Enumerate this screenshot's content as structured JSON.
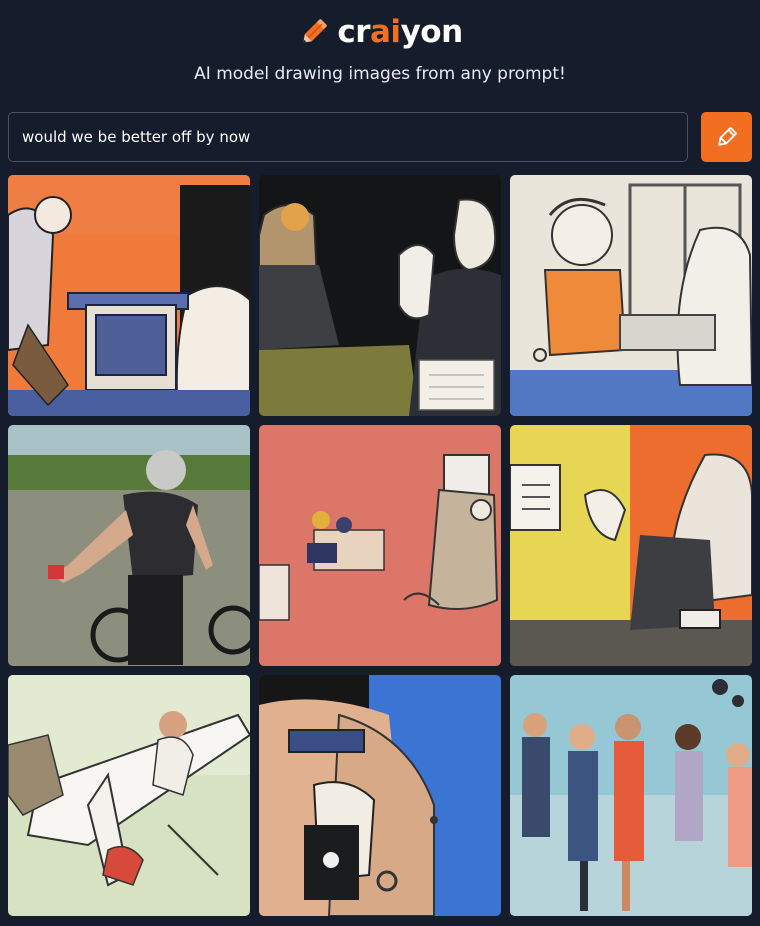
{
  "brand": {
    "name_prefix": "cr",
    "name_accent": "ai",
    "name_suffix": "yon",
    "accent_color": "#f26f21",
    "logo_icon": "pencil-icon"
  },
  "tagline": "AI model drawing images from any prompt!",
  "prompt": {
    "value": "would we be better off by now",
    "placeholder": ""
  },
  "draw_button": {
    "icon": "pencil-icon",
    "color": "#f26f21"
  },
  "results": {
    "count": 9,
    "tiles": [
      {
        "index": 1,
        "depicts": "cartoon figures at a desk, orange background"
      },
      {
        "index": 2,
        "depicts": "cartoon figure at a lectern, dark background"
      },
      {
        "index": 3,
        "depicts": "cartoon figures in an office"
      },
      {
        "index": 4,
        "depicts": "photo of a person on a bicycle"
      },
      {
        "index": 5,
        "depicts": "small figures on a pink background"
      },
      {
        "index": 6,
        "depicts": "figure holding a paper, yellow and orange background"
      },
      {
        "index": 7,
        "depicts": "sketch of figures around an airplane"
      },
      {
        "index": 8,
        "depicts": "close-up cartoon head, blue background"
      },
      {
        "index": 9,
        "depicts": "group of people standing"
      }
    ]
  }
}
